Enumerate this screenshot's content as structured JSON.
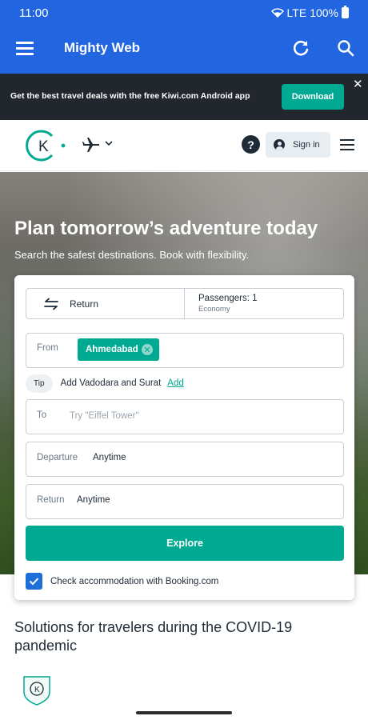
{
  "status_bar": {
    "time": "11:00",
    "network": "LTE",
    "battery": "100%"
  },
  "app_bar": {
    "title": "Mighty Web",
    "icons": [
      "menu-icon",
      "refresh-icon",
      "search-icon"
    ]
  },
  "banner": {
    "text": "Get the best travel deals with the free Kiwi.com Android app",
    "download_label": "Download",
    "close_label": "✕"
  },
  "kiwi_header": {
    "logo_letter": "K",
    "help_label": "?",
    "sign_in_label": "Sign in"
  },
  "hero": {
    "title": "Plan tomorrow’s adventure today",
    "subtitle": "Search the safest destinations. Book with flexibility."
  },
  "search": {
    "trip_type": "Return",
    "passengers": "Passengers: 1",
    "cabin_class": "Economy",
    "from_label": "From",
    "from_chip": "Ahmedabad",
    "tip_badge": "Tip",
    "tip_text": "Add Vadodara and Surat",
    "tip_action": "Add",
    "to_label": "To",
    "to_placeholder": "Try \"Eiffel Tower\"",
    "departure_label": "Departure",
    "departure_value": "Anytime",
    "return_label": "Return",
    "return_value": "Anytime",
    "explore_label": "Explore",
    "booking_checked": true,
    "booking_label": "Check accommodation with Booking.com"
  },
  "covid_heading": "Solutions for travelers during the COVID-19 pandemic",
  "colors": {
    "app_bar": "#2166e0",
    "banner": "#22272d",
    "accent": "#00a991",
    "checkbox": "#1e6fd9"
  }
}
